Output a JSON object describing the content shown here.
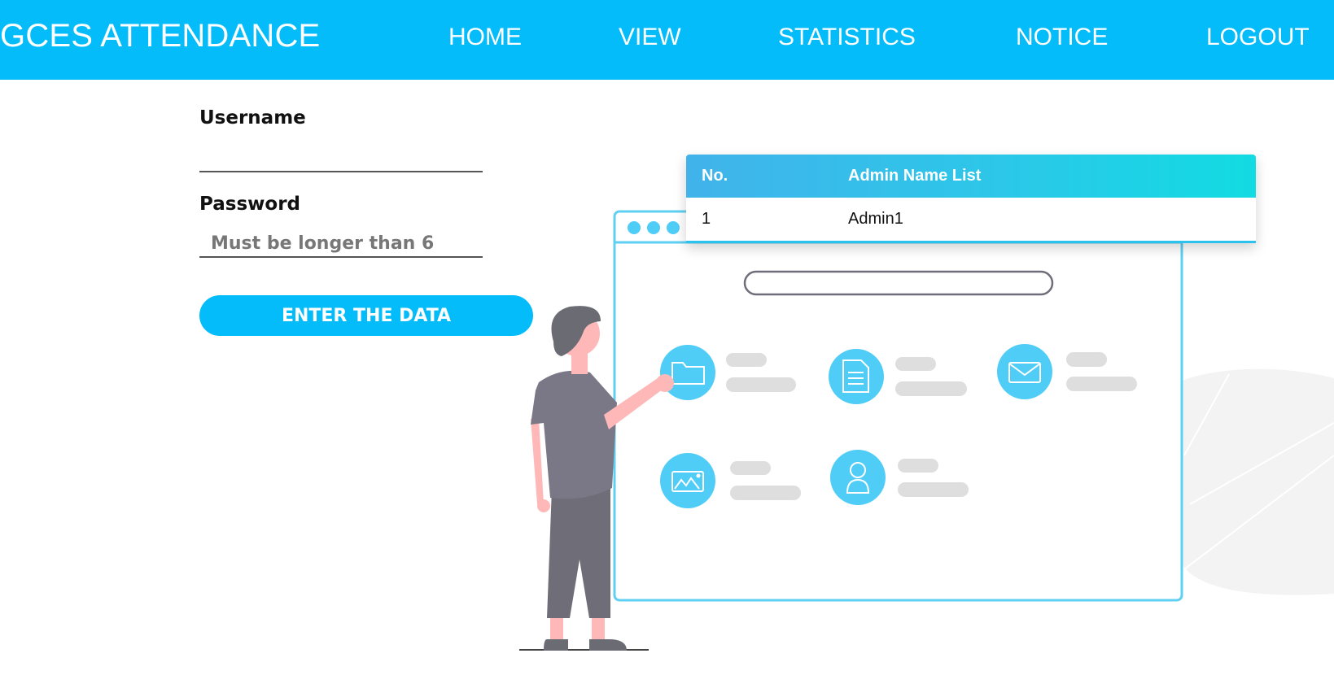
{
  "app": {
    "brand": "GCES ATTENDANCE",
    "brand_color": "#03bcf9"
  },
  "nav": {
    "items": [
      {
        "label": "HOME"
      },
      {
        "label": "VIEW"
      },
      {
        "label": "STATISTICS"
      },
      {
        "label": "NOTICE"
      },
      {
        "label": "LOGOUT"
      }
    ]
  },
  "form": {
    "username_label": "Username",
    "username_value": "",
    "password_label": "Password",
    "password_placeholder": "Must be longer than 6",
    "submit_label": "ENTER THE DATA"
  },
  "table": {
    "headers": [
      "No.",
      "Admin Name List"
    ],
    "rows": [
      [
        "1",
        "Admin1"
      ]
    ]
  },
  "illustration": {
    "icons": [
      "folder-icon",
      "document-icon",
      "mail-icon",
      "image-icon",
      "user-icon"
    ],
    "accent": "#4fcdf7"
  }
}
